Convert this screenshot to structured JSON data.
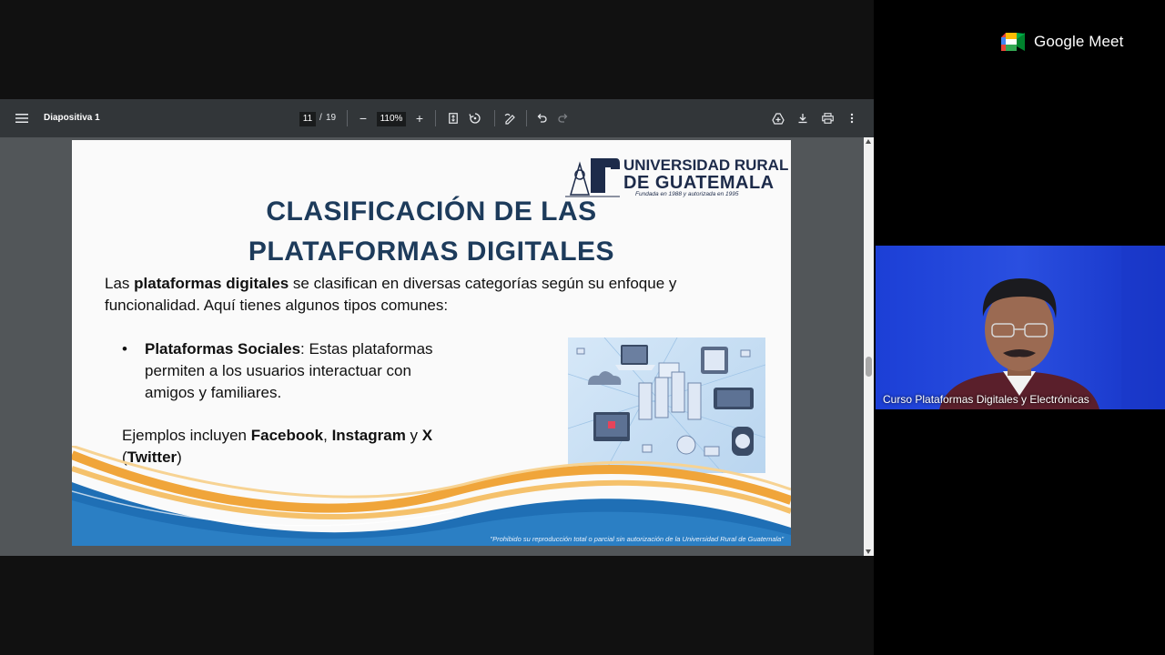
{
  "viewer": {
    "doc_title": "Diapositiva 1",
    "current_page": "11",
    "page_separator": "/",
    "total_pages": "19",
    "zoom": "110%",
    "minus_label": "−",
    "plus_label": "+"
  },
  "slide": {
    "logo_line1": "UNIVERSIDAD RURAL",
    "logo_line2": "DE GUATEMALA",
    "logo_tagline": "Fundada en 1988 y autorizada en 1995",
    "title_line1": "CLASIFICACIÓN DE LAS",
    "title_line2": "PLATAFORMAS DIGITALES",
    "intro_prefix": "Las ",
    "intro_bold": "plataformas digitales",
    "intro_rest": " se clasifican en diversas categorías según su enfoque y",
    "intro_line2": "funcionalidad. Aquí tienes algunos tipos comunes:",
    "bullet_bold": "Plataformas Sociales",
    "bullet_rest1": ": Estas plataformas",
    "bullet_line2": "permiten a los usuarios interactuar con",
    "bullet_line3": "amigos y familiares.",
    "examples_prefix": "Ejemplos incluyen ",
    "ex1": "Facebook",
    "comma": ", ",
    "ex2": "Instagram",
    "and": " y ",
    "ex3": "X",
    "open_paren": "(",
    "ex4": "Twitter",
    "close_paren": ")",
    "footer": "\"Prohibido su reproducción total o parcial sin autorización de la Universidad Rural de Guatemala\""
  },
  "meet": {
    "brand": "Google Meet",
    "participant_caption": "Curso Plataformas Digitales y Electrónicas"
  },
  "icons": [
    "menu-icon",
    "fit-page-icon",
    "rotate-icon",
    "annotate-icon",
    "undo-icon",
    "redo-icon",
    "add-to-drive-icon",
    "download-icon",
    "print-icon",
    "more-options-icon",
    "google-meet-logo-icon"
  ],
  "colors": {
    "toolbar_bg": "#323639",
    "doc_bg": "#525659",
    "title_color": "#1d3b5b",
    "video_bg": "#2a4fe0",
    "wave_blue": "#1f6fb5",
    "wave_orange": "#f0a53a"
  }
}
